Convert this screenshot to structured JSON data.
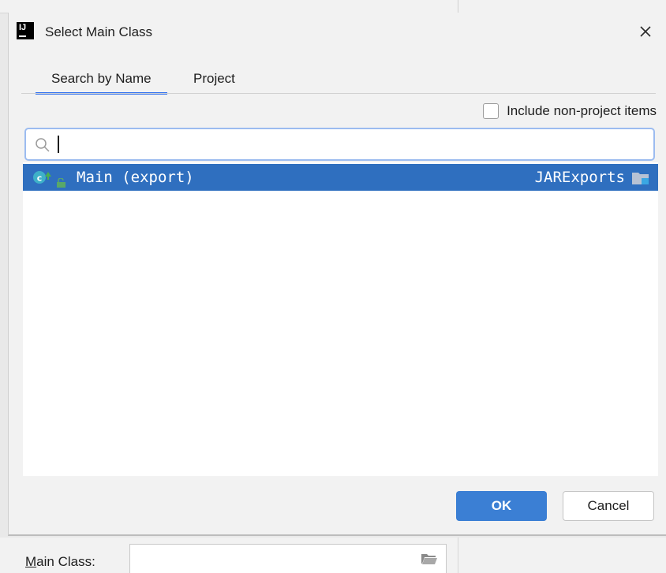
{
  "dialog": {
    "title": "Select Main Class",
    "close_label": "×"
  },
  "tabs": [
    {
      "label": "Search by Name",
      "selected": true
    },
    {
      "label": "Project",
      "selected": false
    }
  ],
  "include_non_project": {
    "label": "Include non-project items",
    "checked": false
  },
  "search": {
    "value": "",
    "placeholder": ""
  },
  "results": [
    {
      "name": "Main (export)",
      "module": "JARExports",
      "selected": true
    }
  ],
  "buttons": {
    "ok": "OK",
    "cancel": "Cancel"
  },
  "background": {
    "main_class_label_mnemonic": "M",
    "main_class_label_rest": "ain Class:"
  },
  "colors": {
    "accent": "#3574f0",
    "selection": "#2f6fbf",
    "ok_button": "#3b7fd4"
  },
  "icons": {
    "logo": "intellij-logo-icon",
    "search": "search-icon",
    "class": "class-icon",
    "module": "module-folder-icon"
  }
}
